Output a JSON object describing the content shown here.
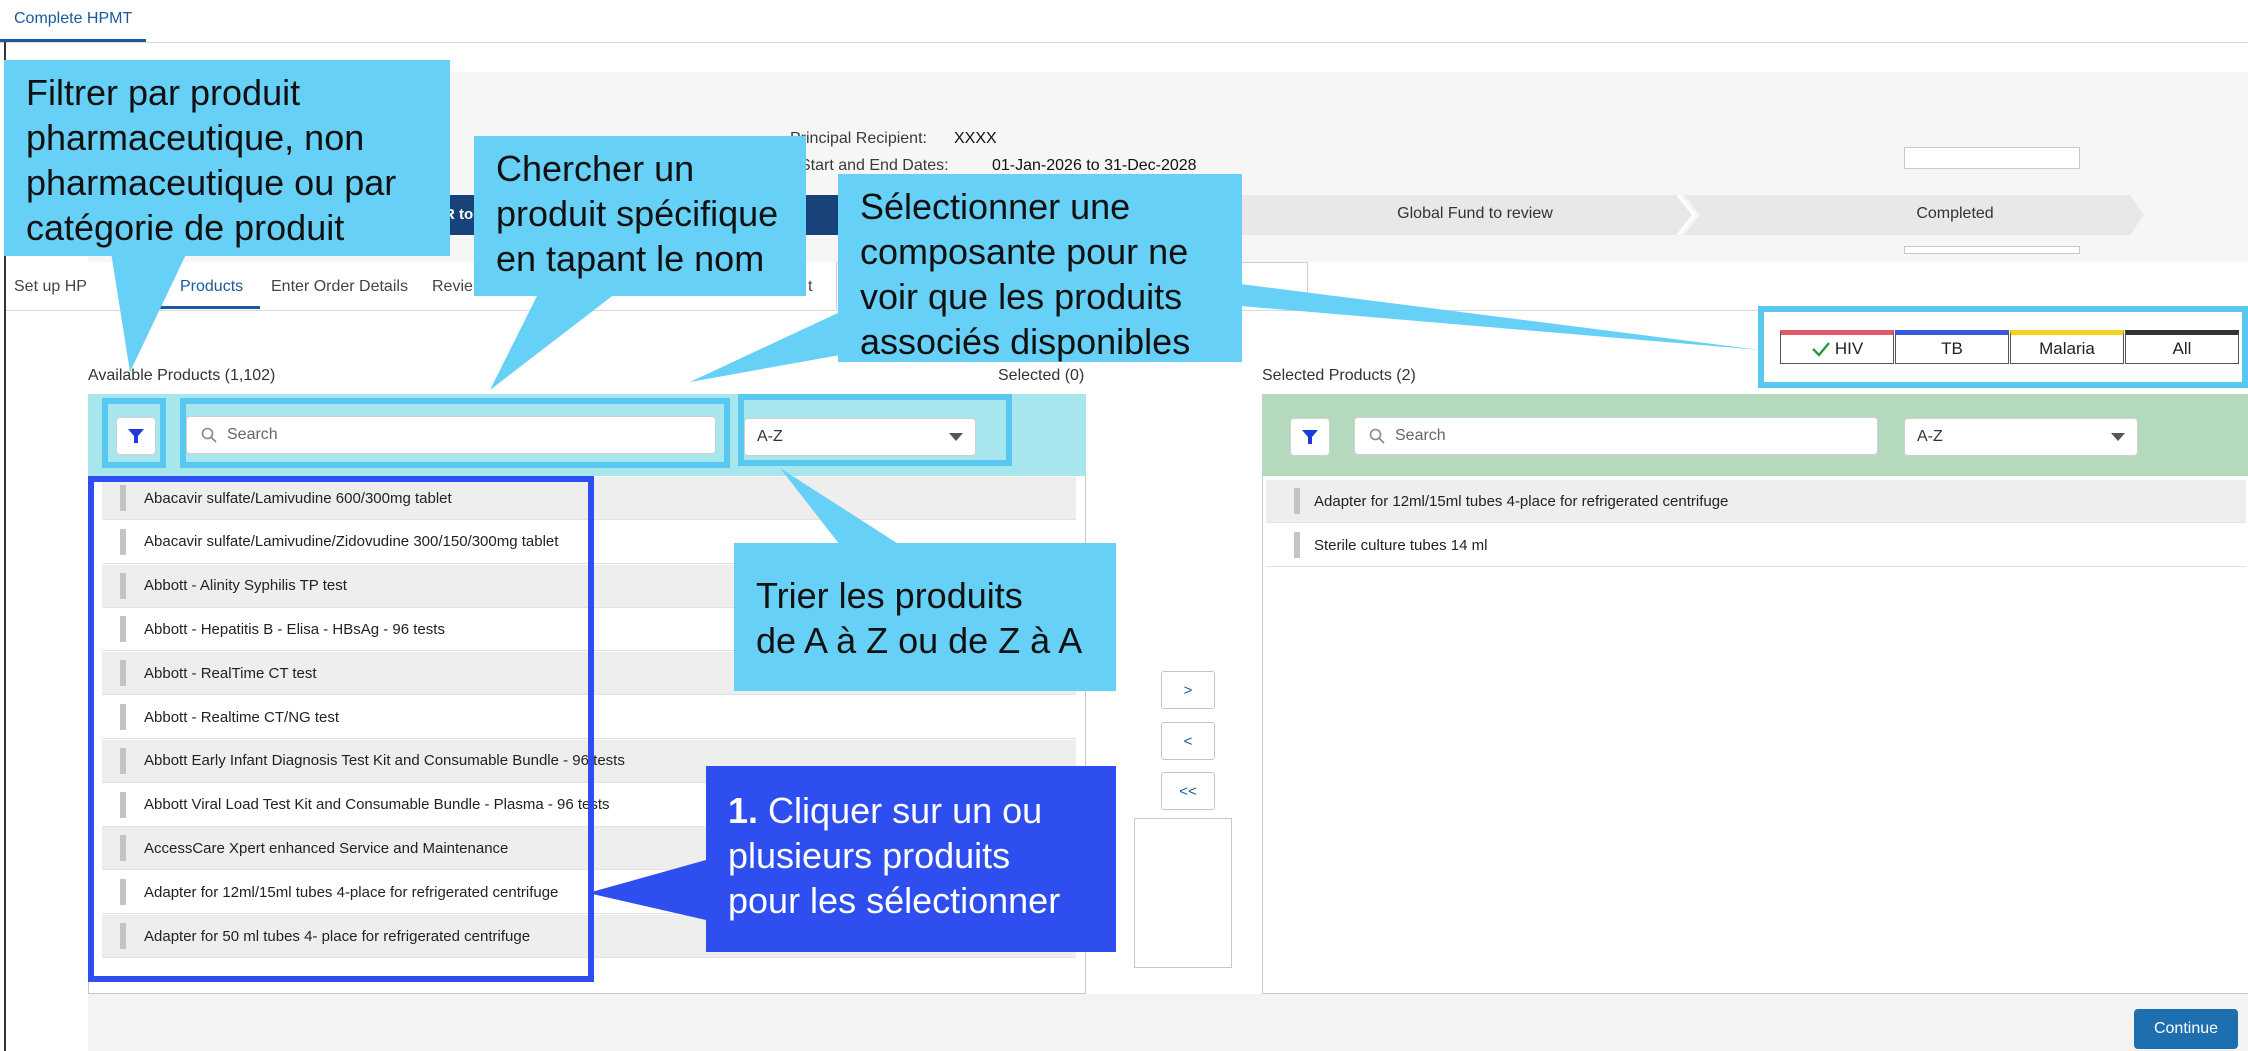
{
  "top_tab": "Complete HPMT",
  "meta": {
    "recipient_label": "Principal Recipient:",
    "recipient_value": "XXXX",
    "dates_label": "Start and End Dates:",
    "dates_value": "01-Jan-2026 to 31-Dec-2028"
  },
  "steps": {
    "active_fragment": "R to",
    "review": "Global Fund to review",
    "completed": "Completed"
  },
  "nav_tabs": [
    "Set up HP",
    "Products",
    "Enter Order Details",
    "Revie",
    "t"
  ],
  "available": {
    "label": "Available Products (1,102)",
    "selected_count": "Selected (0)",
    "search_placeholder": "Search",
    "sort_value": "A-Z",
    "items": [
      "Abacavir sulfate/Lamivudine 600/300mg tablet",
      "Abacavir sulfate/Lamivudine/Zidovudine 300/150/300mg tablet",
      "Abbott - Alinity Syphilis TP test",
      "Abbott - Hepatitis B - Elisa - HBsAg - 96 tests",
      "Abbott - RealTime CT test",
      "Abbott - Realtime CT/NG test",
      "Abbott Early Infant Diagnosis Test Kit and Consumable Bundle - 96 tests",
      "Abbott Viral Load Test Kit and Consumable Bundle - Plasma - 96 tests",
      "AccessCare Xpert enhanced Service and Maintenance",
      "Adapter for 12ml/15ml tubes 4-place for refrigerated centrifuge",
      "Adapter for 50 ml tubes 4- place for refrigerated centrifuge"
    ]
  },
  "selected": {
    "label": "Selected Products (2)",
    "search_placeholder": "Search",
    "sort_value": "A-Z",
    "items": [
      "Adapter for 12ml/15ml tubes 4-place for refrigerated centrifuge",
      "Sterile culture tubes 14 ml"
    ]
  },
  "move_buttons": {
    "add": ">",
    "remove": "<",
    "remove_all": "<<"
  },
  "components": [
    {
      "label": "HIV",
      "color": "#e05a6a",
      "checked": true
    },
    {
      "label": "TB",
      "color": "#3a5ad8",
      "checked": false
    },
    {
      "label": "Malaria",
      "color": "#f2d21a",
      "checked": false
    },
    {
      "label": "All",
      "color": "#333333",
      "checked": false
    }
  ],
  "continue_label": "Continue",
  "callouts": {
    "filter": [
      "Filtrer par produit",
      "pharmaceutique, non",
      "pharmaceutique ou par",
      "catégorie de produit"
    ],
    "search": [
      "Chercher un",
      "produit spécifique",
      "en tapant le nom"
    ],
    "component": [
      "Sélectionner une",
      "composante pour ne",
      "voir que les produits",
      "associés disponibles"
    ],
    "sort": [
      "Trier les produits",
      "de A à Z ou de Z à A"
    ],
    "select_num": "1.",
    "select": [
      "Cliquer sur un ou",
      "plusieurs produits",
      "pour les sélectionner"
    ]
  },
  "colors": {
    "callout_light": "#66d0f6",
    "callout_dark": "#2f4ef0",
    "active_step": "#17427a",
    "primary_button": "#1e6fb0"
  }
}
